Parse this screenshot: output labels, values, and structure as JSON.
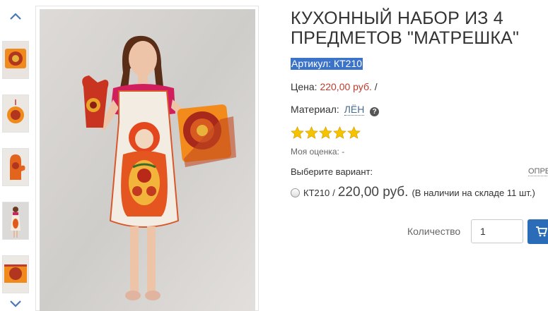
{
  "product": {
    "title": "КУХОННЫЙ НАБОР ИЗ 4 ПРЕДМЕТОВ \"МАТРЕШКА\"",
    "sku_line": "Артикул: КТ210",
    "price_label": "Цена:",
    "price_value": "220,00 руб.",
    "price_suffix": "/",
    "material_label": "Материал:",
    "material_value": "ЛЁН",
    "rating_stars": 5,
    "my_rating": "Моя оценка: -"
  },
  "variants": {
    "label": "Выберите вариант:",
    "link": "ОПРЕ",
    "options": [
      {
        "sku": "КТ210",
        "separator": "/",
        "price": "220,00 руб.",
        "stock": "(В наличии на складе 11 шт.)"
      }
    ]
  },
  "order": {
    "qty_label": "Количество",
    "qty_value": "1"
  },
  "gallery": {
    "thumbnail_count": 5
  },
  "colors": {
    "accent": "#2a6cb8",
    "price": "#c0392b",
    "selection": "#3b73c9",
    "star": "#f5b800"
  }
}
